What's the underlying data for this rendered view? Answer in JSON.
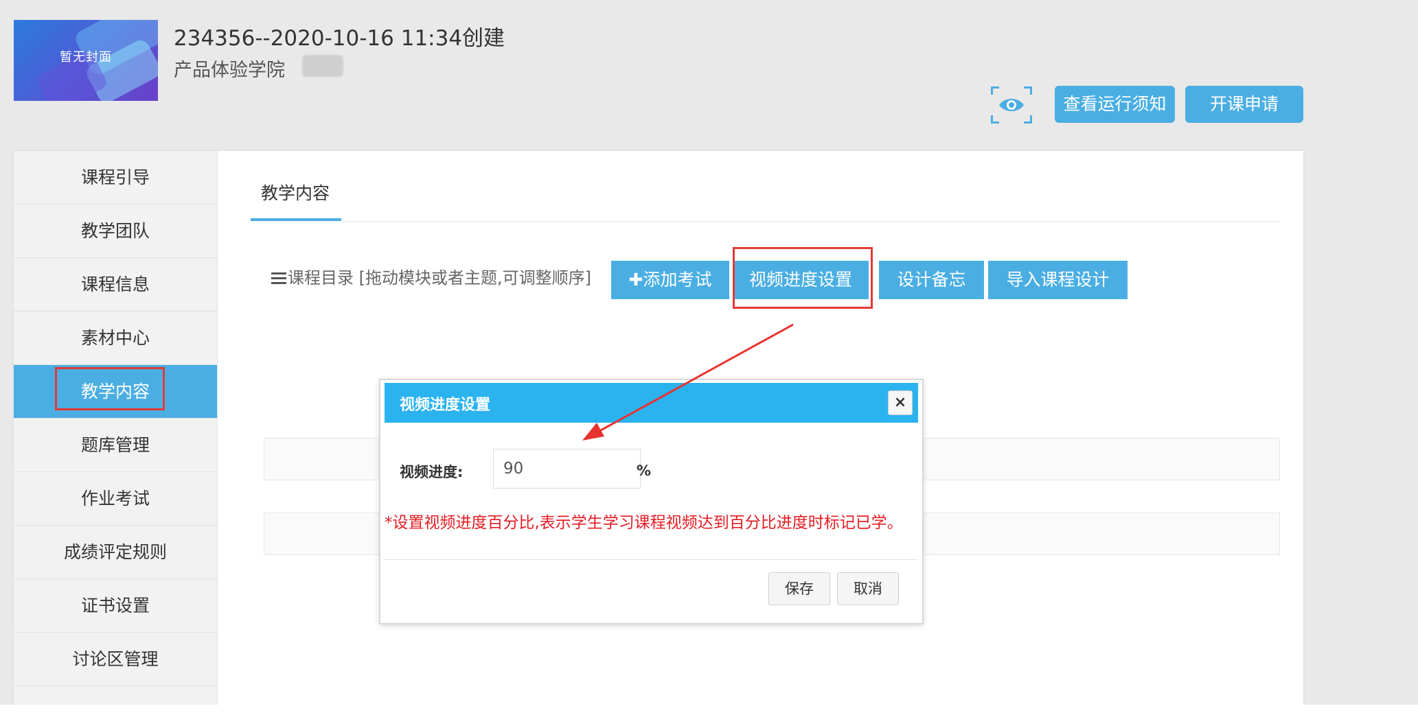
{
  "header": {
    "cover_text": "暂无封面",
    "course_title": "234356--2020-10-16 11:34创建",
    "school_name": "产品体验学院",
    "preview_icon": "eye-icon",
    "rules_button": "查看运行须知",
    "apply_button": "开课申请"
  },
  "sidebar": {
    "items": [
      {
        "label": "课程引导"
      },
      {
        "label": "教学团队"
      },
      {
        "label": "课程信息"
      },
      {
        "label": "素材中心"
      },
      {
        "label": "教学内容",
        "active": true
      },
      {
        "label": "题库管理"
      },
      {
        "label": "作业考试"
      },
      {
        "label": "成绩评定规则"
      },
      {
        "label": "证书设置"
      },
      {
        "label": "讨论区管理"
      }
    ]
  },
  "main": {
    "tab_label": "教学内容",
    "catalog_label": "课程目录 [拖动模块或者主题,可调整顺序]",
    "toolbar": {
      "add_exam": "✚添加考试",
      "video_progress": "视频进度设置",
      "design_memo": "设计备忘",
      "import_design": "导入课程设计"
    }
  },
  "modal": {
    "title": "视频进度设置",
    "close_icon": "close-icon",
    "field_label": "视频进度:",
    "field_value": "90",
    "field_unit": "%",
    "hint": "*设置视频进度百分比,表示学生学习课程视频达到百分比进度时标记已学。",
    "save_button": "保存",
    "cancel_button": "取消"
  },
  "colors": {
    "accent": "#4aaee3",
    "modal_header": "#2bb3f0",
    "highlight": "#e53935",
    "hint_text": "#e51c23"
  }
}
